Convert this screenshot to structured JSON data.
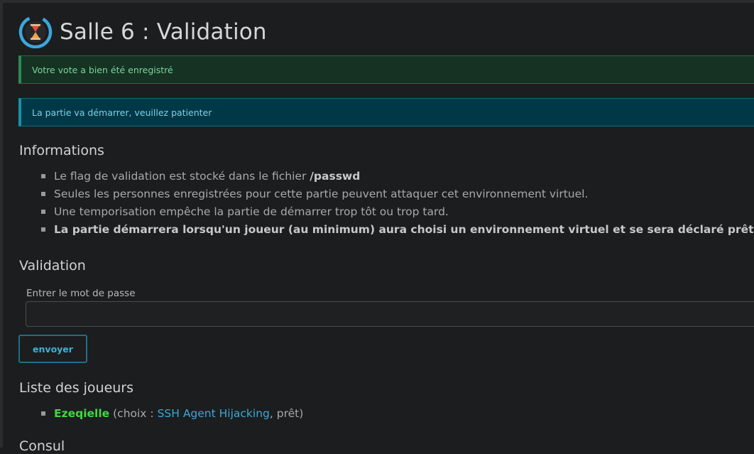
{
  "header": {
    "title": "Salle 6 : Validation",
    "icon": "hourglass-timer-icon"
  },
  "alerts": {
    "success": "Votre vote a bien été enregistré",
    "info": "La partie va démarrer, veuillez patienter"
  },
  "informations": {
    "heading": "Informations",
    "items": [
      {
        "text": "Le flag de validation est stocké dans le fichier ",
        "strong": "/passwd"
      },
      {
        "text": "Seules les personnes enregistrées pour cette partie peuvent attaquer cet environnement virtuel."
      },
      {
        "text": "Une temporisation empêche la partie de démarrer trop tôt ou trop tard."
      },
      {
        "strong": "La partie démarrera lorsqu'un joueur (au minimum) aura choisi un environnement virtuel et se sera déclaré prêt."
      }
    ]
  },
  "validation": {
    "heading": "Validation",
    "password_label": "Entrer le mot de passe",
    "password_value": "",
    "submit_label": "envoyer"
  },
  "players": {
    "heading": "Liste des joueurs",
    "items": [
      {
        "name": "Ezeqielle",
        "choice_prefix": "(choix : ",
        "environment": "SSH Agent Hijacking",
        "suffix": ", prêt)"
      }
    ]
  },
  "next_section_partial": "Consul",
  "colors": {
    "background": "#1c1d1f",
    "success": "#7ed39a",
    "info": "#7fd2e3",
    "accent": "#3fb2d6",
    "player": "#3fd93f"
  }
}
